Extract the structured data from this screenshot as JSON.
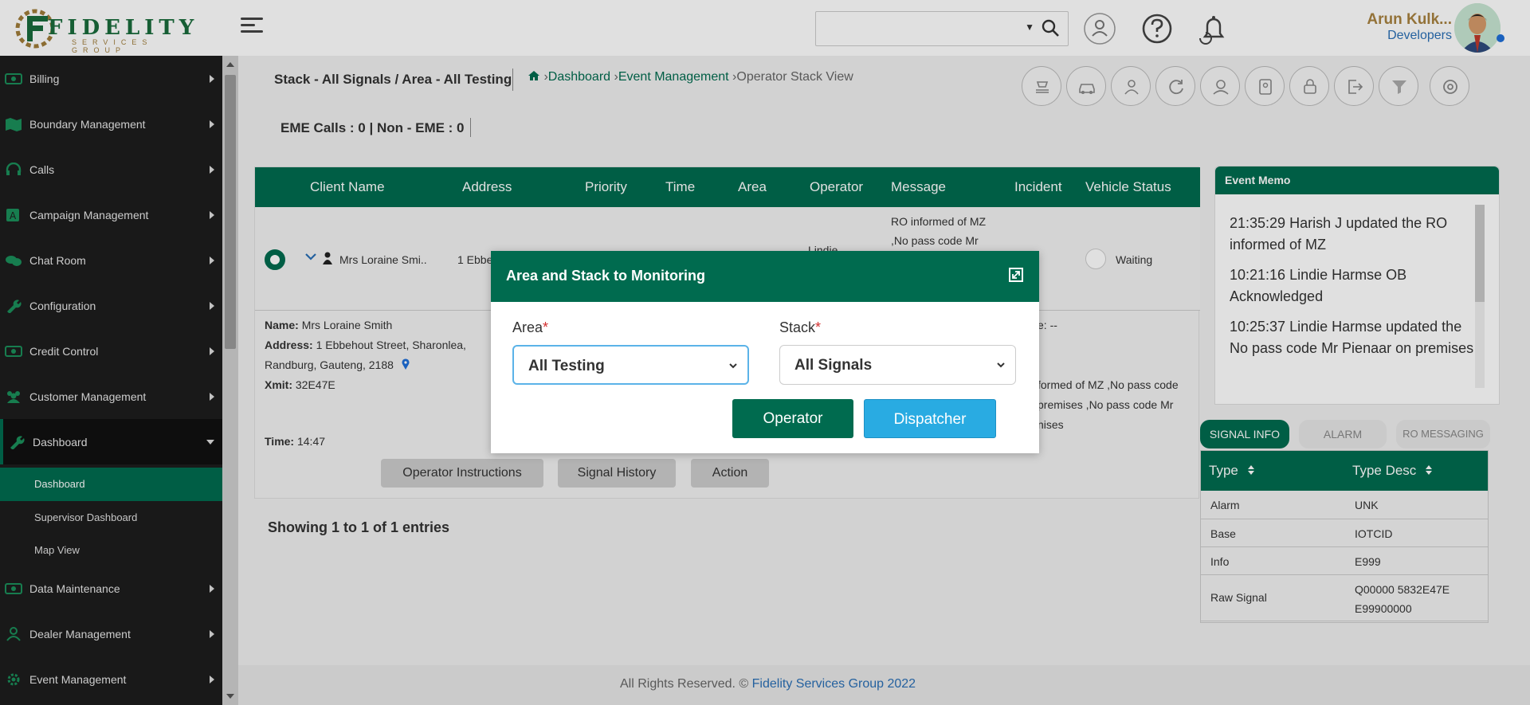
{
  "header": {
    "logo_text": "FIDELITY",
    "logo_sub": "SERVICES GROUP",
    "user_name": "Arun Kulk...",
    "user_role": "Developers"
  },
  "sidebar": {
    "items": [
      {
        "label": "Billing"
      },
      {
        "label": "Boundary Management"
      },
      {
        "label": "Calls"
      },
      {
        "label": "Campaign Management"
      },
      {
        "label": "Chat Room"
      },
      {
        "label": "Configuration"
      },
      {
        "label": "Credit Control"
      },
      {
        "label": "Customer Management"
      },
      {
        "label": "Dashboard"
      },
      {
        "label": "Data Maintenance"
      },
      {
        "label": "Dealer Management"
      },
      {
        "label": "Event Management"
      }
    ],
    "subitems": [
      {
        "label": "Dashboard"
      },
      {
        "label": "Supervisor Dashboard"
      },
      {
        "label": "Map View"
      }
    ]
  },
  "main": {
    "page_title": "Stack - All Signals / Area - All Testing",
    "breadcrumb": {
      "dashboard": "Dashboard",
      "event_management": "Event Management",
      "current": "Operator Stack View",
      "sep": "›"
    },
    "eme_counts": "EME Calls : 0 | Non - EME : 0"
  },
  "table": {
    "headers": [
      "Client Name",
      "Address",
      "Priority",
      "Time",
      "Area",
      "Operator",
      "Message",
      "Incident",
      "Vehicle Status"
    ],
    "row": {
      "client": "Mrs Loraine Smi..",
      "address": "1 Ebbe",
      "operator": "Lindie",
      "message_line1": "RO informed of MZ",
      "message_line2": ",No pass code Mr",
      "vehicle_status": "Waiting"
    },
    "detail": {
      "name_label": "Name:",
      "name": "Mrs Loraine Smith",
      "address_label": "Address:",
      "address_line1": "1 Ebbehout Street, Sharonlea,",
      "address_line2": "Randburg, Gauteng, 2188",
      "xmit_label": "Xmit:",
      "xmit": "32E47E",
      "time_label": "Time:",
      "time": "14:47",
      "right_label": "e: --",
      "right_line1": "formed of MZ ,No pass code",
      "right_line2": "premises ,No pass code Mr",
      "right_line3": "nises"
    },
    "buttons": {
      "operator_instructions": "Operator Instructions",
      "signal_history": "Signal History",
      "action": "Action"
    },
    "showing": "Showing 1 to 1 of 1 entries"
  },
  "memo": {
    "title": "Event Memo",
    "entries": [
      "21:35:29 Harish J updated the RO informed of MZ",
      "10:21:16 Lindie Harmse OB Acknowledged",
      "10:25:37 Lindie Harmse updated the No pass code Mr Pienaar on premises"
    ]
  },
  "signal_tabs": [
    "SIGNAL INFO",
    "ALARM",
    "RO MESSAGING"
  ],
  "signal_table": {
    "headers": [
      "Type",
      "Type Desc"
    ],
    "rows": [
      {
        "k": "Alarm",
        "v": "UNK"
      },
      {
        "k": "Base",
        "v": "IOTCID"
      },
      {
        "k": "Info",
        "v": "E999"
      },
      {
        "k": "Raw Signal",
        "v": "Q00000 5832E47E E99900000"
      }
    ]
  },
  "footer": {
    "text": "All Rights Reserved. ©",
    "link": "Fidelity Services Group 2022"
  },
  "modal": {
    "title": "Area and Stack to Monitoring",
    "area_label": "Area",
    "stack_label": "Stack",
    "required_mark": "*",
    "area_value": "All Testing",
    "stack_value": "All Signals",
    "operator_button": "Operator",
    "dispatcher_button": "Dispatcher"
  },
  "colors": {
    "primary": "#006b4f",
    "accent_blue": "#29abe2",
    "gold": "#a88240"
  }
}
